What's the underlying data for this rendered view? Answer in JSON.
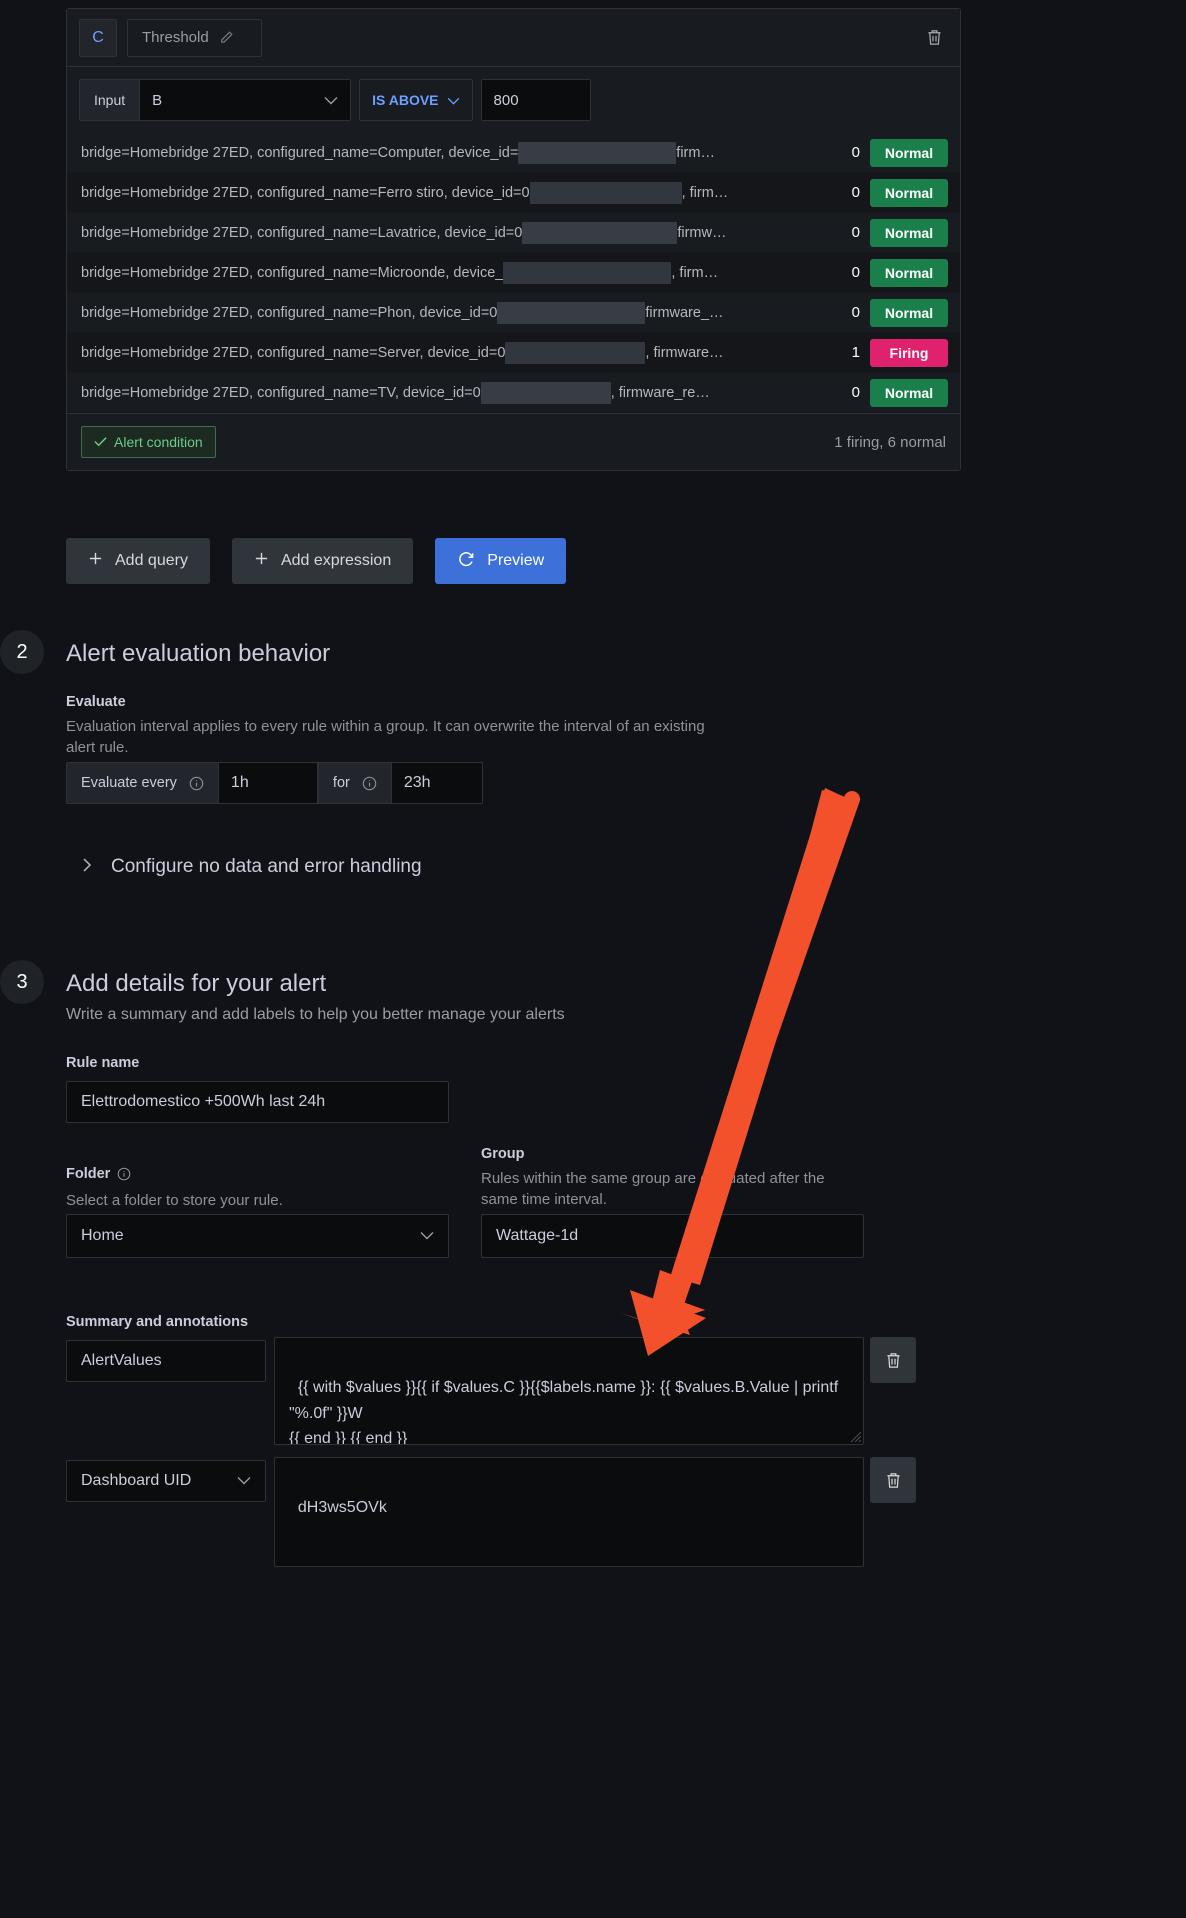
{
  "expression": {
    "ref_id": "C",
    "name": "Threshold",
    "edit_icon": "pencil-icon",
    "delete_icon": "trash-icon",
    "input_label": "Input",
    "input_value": "B",
    "condition": "IS ABOVE",
    "threshold_value": "800",
    "instances": [
      {
        "prefix": "bridge=Homebridge 27ED, configured_name=Computer, device_id=",
        "redact_width": 158,
        "suffix": " firm…",
        "value": "0",
        "state": "Normal"
      },
      {
        "prefix": "bridge=Homebridge 27ED, configured_name=Ferro stiro, device_id=0",
        "redact_width": 152,
        "suffix": ", firm…",
        "value": "0",
        "state": "Normal"
      },
      {
        "prefix": "bridge=Homebridge 27ED, configured_name=Lavatrice, device_id=0",
        "redact_width": 155,
        "suffix": "firmw…",
        "value": "0",
        "state": "Normal"
      },
      {
        "prefix": "bridge=Homebridge 27ED, configured_name=Microonde, device_",
        "redact_width": 168,
        "suffix": ", firm…",
        "value": "0",
        "state": "Normal"
      },
      {
        "prefix": "bridge=Homebridge 27ED, configured_name=Phon, device_id=0",
        "redact_width": 148,
        "suffix": " firmware_…",
        "value": "0",
        "state": "Normal"
      },
      {
        "prefix": "bridge=Homebridge 27ED, configured_name=Server, device_id=0",
        "redact_width": 140,
        "suffix": ", firmware…",
        "value": "1",
        "state": "Firing"
      },
      {
        "prefix": "bridge=Homebridge 27ED, configured_name=TV, device_id=0",
        "redact_width": 130,
        "suffix": ", firmware_re…",
        "value": "0",
        "state": "Normal"
      }
    ],
    "alert_condition_label": "Alert condition",
    "alert_condition_check": "check-icon",
    "summary": "1 firing, 6 normal"
  },
  "actions": {
    "add_query": "Add query",
    "add_expression": "Add expression",
    "preview": "Preview",
    "plus_icon": "plus-icon",
    "refresh_icon": "refresh-icon"
  },
  "step2": {
    "number": "2",
    "title": "Alert evaluation behavior",
    "evaluate_label": "Evaluate",
    "evaluate_help": "Evaluation interval applies to every rule within a group. It can overwrite the interval of an existing alert rule.",
    "evaluate_every_label": "Evaluate every",
    "evaluate_every_value": "1h",
    "for_label": "for",
    "for_value": "23h",
    "info_icon": "info-icon",
    "collapse_label": "Configure no data and error handling",
    "chevron_icon": "chevron-right-icon"
  },
  "step3": {
    "number": "3",
    "title": "Add details for your alert",
    "subtitle": "Write a summary and add labels to help you better manage your alerts",
    "rule_name_label": "Rule name",
    "rule_name_value": "Elettrodomestico +500Wh last 24h",
    "folder_label": "Folder",
    "folder_help": "Select a folder to store your rule.",
    "folder_value": "Home",
    "folder_info_icon": "info-icon",
    "group_label": "Group",
    "group_help": "Rules within the same group are evaluated after the same time interval.",
    "group_value": "Wattage-1d",
    "annotations_label": "Summary and annotations",
    "annotations": [
      {
        "key": "AlertValues",
        "key_is_select": false,
        "value": "{{ with $values }}{{ if $values.C }}{{$labels.name }}: {{ $values.B.Value | printf \"%.0f\" }}W\n{{ end }} {{ end }}",
        "delete_icon": "trash-icon"
      },
      {
        "key": "Dashboard UID",
        "key_is_select": true,
        "value": "dH3ws5OVk",
        "delete_icon": "trash-icon"
      }
    ]
  },
  "colors": {
    "accent_blue": "#3d71d9",
    "normal_green": "#1a7f4b",
    "firing_pink": "#e0226e",
    "arrow_orange": "#f2512c"
  }
}
